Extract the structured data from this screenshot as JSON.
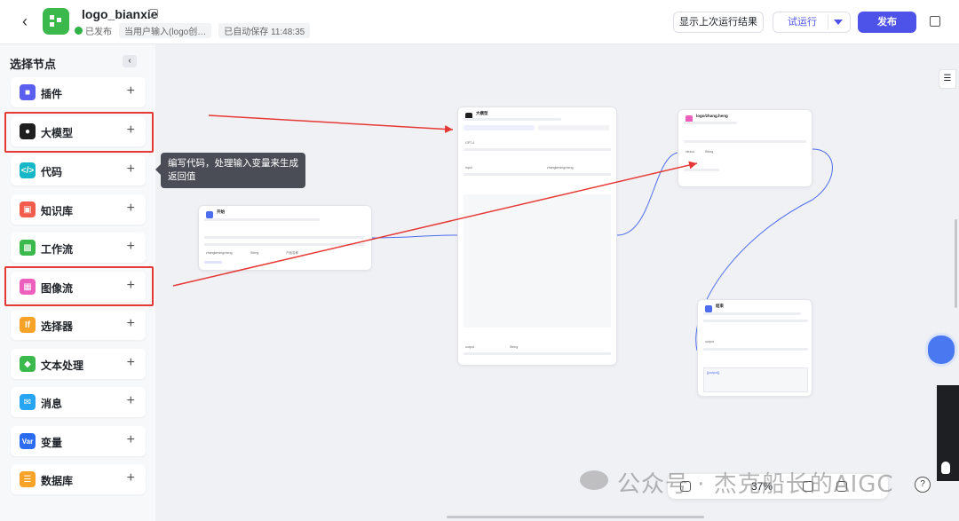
{
  "header": {
    "app_name": "logo_bianxie",
    "status_published": "已发布",
    "input_hint": "当用户输入(logo创…",
    "autosave": "已自动保存 11:48:35",
    "show_last_run": "显示上次运行结果",
    "try_run": "试运行",
    "publish": "发布"
  },
  "sidebar": {
    "title": "选择节点",
    "items": [
      {
        "label": "插件",
        "icon": "plugin-icon",
        "color": "#5b5ff0"
      },
      {
        "label": "大模型",
        "icon": "llm-icon",
        "color": "#1f1f1f"
      },
      {
        "label": "代码",
        "icon": "code-icon",
        "color": "#16b8c7"
      },
      {
        "label": "知识库",
        "icon": "knowledge-icon",
        "color": "#f25c4c"
      },
      {
        "label": "工作流",
        "icon": "workflow-icon",
        "color": "#3bb94c"
      },
      {
        "label": "图像流",
        "icon": "imageflow-icon",
        "color": "#ec5fbd"
      },
      {
        "label": "选择器",
        "icon": "selector-icon",
        "color": "#f7a327"
      },
      {
        "label": "文本处理",
        "icon": "text-icon",
        "color": "#3bb94c"
      },
      {
        "label": "消息",
        "icon": "message-icon",
        "color": "#27a5f2"
      },
      {
        "label": "变量",
        "icon": "variable-icon",
        "color": "#2c6cf2"
      },
      {
        "label": "数据库",
        "icon": "database-icon",
        "color": "#f7a327"
      }
    ]
  },
  "tooltip": "编写代码，处理输入变量来生成返回值",
  "canvas": {
    "start_node": {
      "title": "开始",
      "param": "zhangtemingcheng",
      "type": "String",
      "desc": "产品名称"
    },
    "llm_node": {
      "title": "大模型",
      "model": "GPT-4",
      "input_name": "input",
      "input_ref": "zhangtemingcheng",
      "output_name": "output",
      "output_type": "String"
    },
    "plugin_node": {
      "title": "logo/zhang.heng",
      "param": "xiezuo",
      "type": "String"
    },
    "end_node": {
      "title": "结束",
      "output_name": "output",
      "textarea": "{{output}}"
    }
  },
  "toolbar": {
    "zoom": "37%"
  },
  "watermark": "公众号 · 杰克船长的AIGC"
}
